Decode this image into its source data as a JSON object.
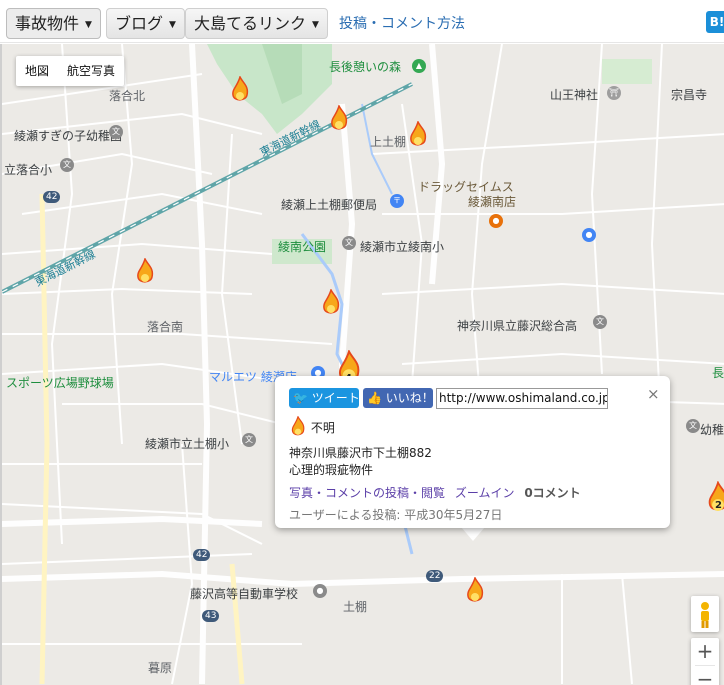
{
  "nav": {
    "menu1": "事故物件",
    "menu2": "ブログ",
    "menu3": "大島てるリンク",
    "link": "投稿・コメント方法",
    "hatena": "B!"
  },
  "map": {
    "maptype_map": "地図",
    "maptype_satellite": "航空写真",
    "labels": {
      "park_nagago": "長後憩いの森",
      "ochiai_kita": "落合北",
      "sanno": "山王神社",
      "soshoji": "宗昌寺",
      "kamitsuchidana_top": "上土棚",
      "sugi_kinder": "綾瀬すぎの子幼稚園",
      "tachi_ochiai": "立落合小",
      "tokaido_1": "東海道新幹線",
      "tokaido_2": "東海道新幹線",
      "drugstore_1": "ドラッグセイムス",
      "drugstore_2": "綾瀬南店",
      "post_office": "綾瀬上土棚郵便局",
      "ayanan_park": "綾南公園",
      "ayanan_school": "綾瀬市立綾南小",
      "ochiai_minami": "落合南",
      "fujisawa_hs": "神奈川県立藤沢総合高",
      "maruetsu": "マルエツ 綾瀬店",
      "baseball": "スポーツ広場野球場",
      "naga": "長",
      "tsuchidana_school": "綾瀬市立土棚小",
      "kindergarten_right": "幼稚園",
      "driving_school": "藤沢高等自動車学校",
      "tsuchidana": "土棚",
      "kuribara": "暮原"
    },
    "routes": {
      "r42a": "42",
      "r42b": "42",
      "r43": "43",
      "r22": "22"
    },
    "clusters": {
      "c4": "4",
      "c2": "2"
    }
  },
  "infowindow": {
    "tweet": "ツイート",
    "like": "いいね！",
    "url": "http://www.oshimaland.co.jp/?",
    "close": "×",
    "title": "不明",
    "address": "神奈川県藤沢市下土棚882",
    "category": "心理的瑕疵物件",
    "link_post": "写真・コメントの投稿・閲覧",
    "link_zoom": "ズームイン",
    "comments": "0コメント",
    "posted": "ユーザーによる投稿: 平成30年5月27日"
  },
  "controls": {
    "zoom_in": "+",
    "zoom_out": "−"
  }
}
